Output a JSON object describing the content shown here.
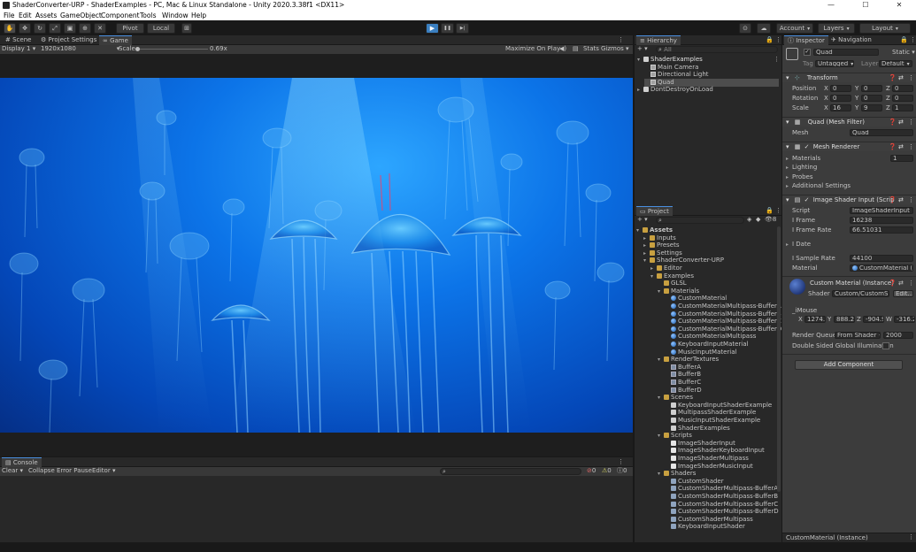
{
  "window": {
    "title": "ShaderConverter-URP - ShaderExamples - PC, Mac & Linux Standalone - Unity 2020.3.38f1 <DX11>",
    "minimize": "—",
    "maximize": "☐",
    "close": "✕"
  },
  "menu": [
    "File",
    "Edit",
    "Assets",
    "GameObject",
    "Component",
    "Tools",
    "Window",
    "Help"
  ],
  "toolbar": {
    "pivot": "Pivot",
    "local": "Local",
    "play": "▶",
    "pause": "❚❚",
    "step": "▶|",
    "account": "Account",
    "layers": "Layers",
    "layout": "Layout"
  },
  "game_tabs": {
    "scene": "Scene",
    "project_settings": "Project Settings",
    "game": "Game"
  },
  "game_bar": {
    "display": "Display 1",
    "resolution": "1920x1080",
    "scale_label": "Scale",
    "scale_value": "0.69x",
    "maximize": "Maximize On Play",
    "stats": "Stats",
    "gizmos": "Gizmos"
  },
  "console": {
    "tab": "Console",
    "clear": "Clear",
    "collapse": "Collapse",
    "error_pause": "Error Pause",
    "editor": "Editor",
    "count_errors": "0",
    "count_warnings": "0",
    "count_logs": "0"
  },
  "hierarchy": {
    "tab": "Hierarchy",
    "search_placeholder": "All",
    "items": [
      {
        "label": "ShaderExamples",
        "indent": 0,
        "arrow": "▾",
        "icon": "scene",
        "hl": true
      },
      {
        "label": "Main Camera",
        "indent": 1,
        "arrow": "",
        "icon": "go"
      },
      {
        "label": "Directional Light",
        "indent": 1,
        "arrow": "",
        "icon": "go"
      },
      {
        "label": "Quad",
        "indent": 1,
        "arrow": "",
        "icon": "go",
        "sel": true
      },
      {
        "label": "DontDestroyOnLoad",
        "indent": 0,
        "arrow": "▸",
        "icon": "scene"
      }
    ]
  },
  "project": {
    "tab": "Project",
    "count": "8",
    "items": [
      {
        "label": "Assets",
        "indent": 0,
        "arrow": "▾",
        "icon": "folder",
        "bold": true
      },
      {
        "label": "Inputs",
        "indent": 1,
        "arrow": "▸",
        "icon": "folder"
      },
      {
        "label": "Presets",
        "indent": 1,
        "arrow": "▸",
        "icon": "folder"
      },
      {
        "label": "Settings",
        "indent": 1,
        "arrow": "▸",
        "icon": "folder"
      },
      {
        "label": "ShaderConverter-URP",
        "indent": 1,
        "arrow": "▾",
        "icon": "folder"
      },
      {
        "label": "Editor",
        "indent": 2,
        "arrow": "▸",
        "icon": "folder"
      },
      {
        "label": "Examples",
        "indent": 2,
        "arrow": "▾",
        "icon": "folder"
      },
      {
        "label": "GLSL",
        "indent": 3,
        "arrow": "",
        "icon": "folder"
      },
      {
        "label": "Materials",
        "indent": 3,
        "arrow": "▾",
        "icon": "folder"
      },
      {
        "label": "CustomMaterial",
        "indent": 4,
        "arrow": "",
        "icon": "mat"
      },
      {
        "label": "CustomMaterialMultipass-BufferA",
        "indent": 4,
        "arrow": "",
        "icon": "mat"
      },
      {
        "label": "CustomMaterialMultipass-BufferB",
        "indent": 4,
        "arrow": "",
        "icon": "mat"
      },
      {
        "label": "CustomMaterialMultipass-BufferC",
        "indent": 4,
        "arrow": "",
        "icon": "mat"
      },
      {
        "label": "CustomMaterialMultipass-BufferD",
        "indent": 4,
        "arrow": "",
        "icon": "mat"
      },
      {
        "label": "CustomMaterialMultipass",
        "indent": 4,
        "arrow": "",
        "icon": "mat"
      },
      {
        "label": "KeyboardInputMaterial",
        "indent": 4,
        "arrow": "",
        "icon": "mat"
      },
      {
        "label": "MusicInputMaterial",
        "indent": 4,
        "arrow": "",
        "icon": "mat"
      },
      {
        "label": "RenderTextures",
        "indent": 3,
        "arrow": "▾",
        "icon": "folder"
      },
      {
        "label": "BufferA",
        "indent": 4,
        "arrow": "",
        "icon": "rt"
      },
      {
        "label": "BufferB",
        "indent": 4,
        "arrow": "",
        "icon": "rt"
      },
      {
        "label": "BufferC",
        "indent": 4,
        "arrow": "",
        "icon": "rt"
      },
      {
        "label": "BufferD",
        "indent": 4,
        "arrow": "",
        "icon": "rt"
      },
      {
        "label": "Scenes",
        "indent": 3,
        "arrow": "▾",
        "icon": "folder"
      },
      {
        "label": "KeyboardInputShaderExample",
        "indent": 4,
        "arrow": "",
        "icon": "scene"
      },
      {
        "label": "MultipassShaderExample",
        "indent": 4,
        "arrow": "",
        "icon": "scene"
      },
      {
        "label": "MusicInputShaderExample",
        "indent": 4,
        "arrow": "",
        "icon": "scene"
      },
      {
        "label": "ShaderExamples",
        "indent": 4,
        "arrow": "",
        "icon": "scene"
      },
      {
        "label": "Scripts",
        "indent": 3,
        "arrow": "▾",
        "icon": "folder"
      },
      {
        "label": "ImageShaderInput",
        "indent": 4,
        "arrow": "",
        "icon": "script"
      },
      {
        "label": "ImageShaderKeyboardInput",
        "indent": 4,
        "arrow": "",
        "icon": "script"
      },
      {
        "label": "ImageShaderMultipass",
        "indent": 4,
        "arrow": "",
        "icon": "script"
      },
      {
        "label": "ImageShaderMusicInput",
        "indent": 4,
        "arrow": "",
        "icon": "script"
      },
      {
        "label": "Shaders",
        "indent": 3,
        "arrow": "▾",
        "icon": "folder"
      },
      {
        "label": "CustomShader",
        "indent": 4,
        "arrow": "",
        "icon": "shader"
      },
      {
        "label": "CustomShaderMultipass-BufferA",
        "indent": 4,
        "arrow": "",
        "icon": "shader"
      },
      {
        "label": "CustomShaderMultipass-BufferB",
        "indent": 4,
        "arrow": "",
        "icon": "shader"
      },
      {
        "label": "CustomShaderMultipass-BufferC",
        "indent": 4,
        "arrow": "",
        "icon": "shader"
      },
      {
        "label": "CustomShaderMultipass-BufferD",
        "indent": 4,
        "arrow": "",
        "icon": "shader"
      },
      {
        "label": "CustomShaderMultipass",
        "indent": 4,
        "arrow": "",
        "icon": "shader"
      },
      {
        "label": "KeyboardInputShader",
        "indent": 4,
        "arrow": "",
        "icon": "shader"
      }
    ]
  },
  "inspector": {
    "tab": "Inspector",
    "tab2": "Navigation",
    "name": "Quad",
    "static": "Static",
    "tag_label": "Tag",
    "tag": "Untagged",
    "layer_label": "Layer",
    "layer": "Default",
    "transform": {
      "title": "Transform",
      "position": "Position",
      "rotation": "Rotation",
      "scale": "Scale",
      "pos": {
        "x": "0",
        "y": "0",
        "z": "0"
      },
      "rot": {
        "x": "0",
        "y": "0",
        "z": "0"
      },
      "scl": {
        "x": "16",
        "y": "9",
        "z": "1"
      }
    },
    "mesh_filter": {
      "title": "Quad (Mesh Filter)",
      "mesh_label": "Mesh",
      "mesh": "Quad"
    },
    "mesh_renderer": {
      "title": "Mesh Renderer",
      "materials": "Materials",
      "materials_count": "1",
      "lighting": "Lighting",
      "probes": "Probes",
      "additional": "Additional Settings"
    },
    "image_shader": {
      "title": "Image Shader Input (Scrip",
      "script_label": "Script",
      "script": "ImageShaderInput",
      "iframe_label": "I Frame",
      "iframe": "16238",
      "iframerate_label": "I Frame Rate",
      "iframerate": "66.51031",
      "idate_label": "I Date",
      "isamplerate_label": "I Sample Rate",
      "isamplerate": "44100",
      "material_label": "Material",
      "material": "CustomMaterial (I"
    },
    "material": {
      "title": "Custom Material (Instance)",
      "shader_label": "Shader",
      "shader": "Custom/CustomSh",
      "edit": "Edit...",
      "imouse_label": "_iMouse",
      "mx": "1274.2",
      "my": "888.23",
      "mz": "-904.9",
      "mw": "-316.2",
      "render_queue_label": "Render Queue",
      "render_queue_mode": "From Shader",
      "render_queue": "2000",
      "dsgi": "Double Sided Global Illumination"
    },
    "add_component": "Add Component",
    "footer": "CustomMaterial (Instance)"
  }
}
